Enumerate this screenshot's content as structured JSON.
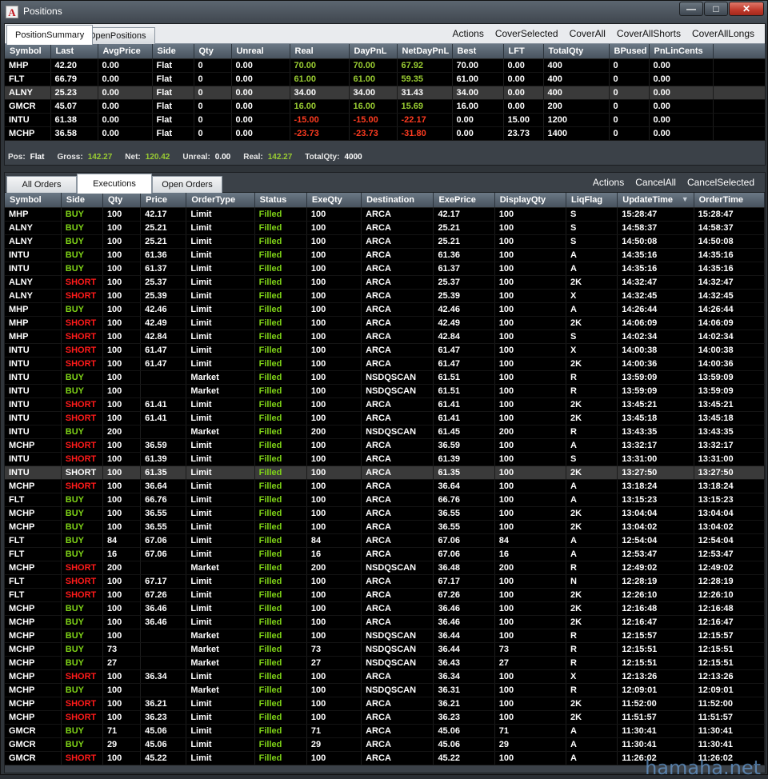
{
  "window": {
    "title": "Positions",
    "icon": "app-logo-icon",
    "controls": [
      "—",
      "□",
      "✕"
    ]
  },
  "summary": {
    "tabs": [
      "PositionSummary",
      "OpenPositions"
    ],
    "actions": [
      "Actions",
      "CoverSelected",
      "CoverAll",
      "CoverAllShorts",
      "CoverAllLongs"
    ],
    "columns": [
      "Symbol",
      "Last",
      "AvgPrice",
      "Side",
      "Qty",
      "Unreal",
      "Real",
      "DayPnL",
      "NetDayPnL",
      "Best",
      "LFT",
      "TotalQty",
      "BPused",
      "PnLinCents"
    ],
    "rows": [
      [
        "MHP",
        "42.20",
        "0.00",
        "Flat",
        "0",
        "0.00",
        "70.00",
        "70.00",
        "67.92",
        "70.00",
        "0.00",
        "400",
        "0",
        "0.00"
      ],
      [
        "FLT",
        "66.79",
        "0.00",
        "Flat",
        "0",
        "0.00",
        "61.00",
        "61.00",
        "59.35",
        "61.00",
        "0.00",
        "400",
        "0",
        "0.00"
      ],
      [
        "ALNY",
        "25.23",
        "0.00",
        "Flat",
        "0",
        "0.00",
        "34.00",
        "34.00",
        "31.43",
        "34.00",
        "0.00",
        "400",
        "0",
        "0.00"
      ],
      [
        "GMCR",
        "45.07",
        "0.00",
        "Flat",
        "0",
        "0.00",
        "16.00",
        "16.00",
        "15.69",
        "16.00",
        "0.00",
        "200",
        "0",
        "0.00"
      ],
      [
        "INTU",
        "61.38",
        "0.00",
        "Flat",
        "0",
        "0.00",
        "-15.00",
        "-15.00",
        "-22.17",
        "0.00",
        "15.00",
        "1200",
        "0",
        "0.00"
      ],
      [
        "MCHP",
        "36.58",
        "0.00",
        "Flat",
        "0",
        "0.00",
        "-23.73",
        "-23.73",
        "-31.80",
        "0.00",
        "23.73",
        "1400",
        "0",
        "0.00"
      ]
    ],
    "selected_row": 2,
    "status": {
      "pos_label": "Pos:",
      "pos_value": "Flat",
      "gross_label": "Gross:",
      "gross_value": "142.27",
      "net_label": "Net:",
      "net_value": "120.42",
      "unreal_label": "Unreal:",
      "unreal_value": "0.00",
      "real_label": "Real:",
      "real_value": "142.27",
      "totalqty_label": "TotalQty:",
      "totalqty_value": "4000"
    }
  },
  "orders": {
    "tabs": [
      "All Orders",
      "Executions",
      "Open Orders"
    ],
    "active_tab": 1,
    "actions": [
      "Actions",
      "CancelAll",
      "CancelSelected"
    ],
    "columns": [
      "Symbol",
      "Side",
      "Qty",
      "Price",
      "OrderType",
      "Status",
      "ExeQty",
      "Destination",
      "ExePrice",
      "DisplayQty",
      "LiqFlag",
      "UpdateTime",
      "OrderTime"
    ],
    "sort_indicator": "▼",
    "rows": [
      [
        "MHP",
        "BUY",
        "100",
        "42.17",
        "Limit",
        "Filled",
        "100",
        "ARCA",
        "42.17",
        "100",
        "S",
        "15:28:47",
        "15:28:47"
      ],
      [
        "ALNY",
        "BUY",
        "100",
        "25.21",
        "Limit",
        "Filled",
        "100",
        "ARCA",
        "25.21",
        "100",
        "S",
        "14:58:37",
        "14:58:37"
      ],
      [
        "ALNY",
        "BUY",
        "100",
        "25.21",
        "Limit",
        "Filled",
        "100",
        "ARCA",
        "25.21",
        "100",
        "S",
        "14:50:08",
        "14:50:08"
      ],
      [
        "INTU",
        "BUY",
        "100",
        "61.36",
        "Limit",
        "Filled",
        "100",
        "ARCA",
        "61.36",
        "100",
        "A",
        "14:35:16",
        "14:35:16"
      ],
      [
        "INTU",
        "BUY",
        "100",
        "61.37",
        "Limit",
        "Filled",
        "100",
        "ARCA",
        "61.37",
        "100",
        "A",
        "14:35:16",
        "14:35:16"
      ],
      [
        "ALNY",
        "SHORT",
        "100",
        "25.37",
        "Limit",
        "Filled",
        "100",
        "ARCA",
        "25.37",
        "100",
        "2K",
        "14:32:47",
        "14:32:47"
      ],
      [
        "ALNY",
        "SHORT",
        "100",
        "25.39",
        "Limit",
        "Filled",
        "100",
        "ARCA",
        "25.39",
        "100",
        "X",
        "14:32:45",
        "14:32:45"
      ],
      [
        "MHP",
        "BUY",
        "100",
        "42.46",
        "Limit",
        "Filled",
        "100",
        "ARCA",
        "42.46",
        "100",
        "A",
        "14:26:44",
        "14:26:44"
      ],
      [
        "MHP",
        "SHORT",
        "100",
        "42.49",
        "Limit",
        "Filled",
        "100",
        "ARCA",
        "42.49",
        "100",
        "2K",
        "14:06:09",
        "14:06:09"
      ],
      [
        "MHP",
        "SHORT",
        "100",
        "42.84",
        "Limit",
        "Filled",
        "100",
        "ARCA",
        "42.84",
        "100",
        "S",
        "14:02:34",
        "14:02:34"
      ],
      [
        "INTU",
        "SHORT",
        "100",
        "61.47",
        "Limit",
        "Filled",
        "100",
        "ARCA",
        "61.47",
        "100",
        "X",
        "14:00:38",
        "14:00:38"
      ],
      [
        "INTU",
        "SHORT",
        "100",
        "61.47",
        "Limit",
        "Filled",
        "100",
        "ARCA",
        "61.47",
        "100",
        "2K",
        "14:00:36",
        "14:00:36"
      ],
      [
        "INTU",
        "BUY",
        "100",
        "",
        "Market",
        "Filled",
        "100",
        "NSDQSCAN",
        "61.51",
        "100",
        "R",
        "13:59:09",
        "13:59:09"
      ],
      [
        "INTU",
        "BUY",
        "100",
        "",
        "Market",
        "Filled",
        "100",
        "NSDQSCAN",
        "61.51",
        "100",
        "R",
        "13:59:09",
        "13:59:09"
      ],
      [
        "INTU",
        "SHORT",
        "100",
        "61.41",
        "Limit",
        "Filled",
        "100",
        "ARCA",
        "61.41",
        "100",
        "2K",
        "13:45:21",
        "13:45:21"
      ],
      [
        "INTU",
        "SHORT",
        "100",
        "61.41",
        "Limit",
        "Filled",
        "100",
        "ARCA",
        "61.41",
        "100",
        "2K",
        "13:45:18",
        "13:45:18"
      ],
      [
        "INTU",
        "BUY",
        "200",
        "",
        "Market",
        "Filled",
        "200",
        "NSDQSCAN",
        "61.45",
        "200",
        "R",
        "13:43:35",
        "13:43:35"
      ],
      [
        "MCHP",
        "SHORT",
        "100",
        "36.59",
        "Limit",
        "Filled",
        "100",
        "ARCA",
        "36.59",
        "100",
        "A",
        "13:32:17",
        "13:32:17"
      ],
      [
        "INTU",
        "SHORT",
        "100",
        "61.39",
        "Limit",
        "Filled",
        "100",
        "ARCA",
        "61.39",
        "100",
        "S",
        "13:31:00",
        "13:31:00"
      ],
      [
        "INTU",
        "SHORT",
        "100",
        "61.35",
        "Limit",
        "Filled",
        "100",
        "ARCA",
        "61.35",
        "100",
        "2K",
        "13:27:50",
        "13:27:50"
      ],
      [
        "MCHP",
        "SHORT",
        "100",
        "36.64",
        "Limit",
        "Filled",
        "100",
        "ARCA",
        "36.64",
        "100",
        "A",
        "13:18:24",
        "13:18:24"
      ],
      [
        "FLT",
        "BUY",
        "100",
        "66.76",
        "Limit",
        "Filled",
        "100",
        "ARCA",
        "66.76",
        "100",
        "A",
        "13:15:23",
        "13:15:23"
      ],
      [
        "MCHP",
        "BUY",
        "100",
        "36.55",
        "Limit",
        "Filled",
        "100",
        "ARCA",
        "36.55",
        "100",
        "2K",
        "13:04:04",
        "13:04:04"
      ],
      [
        "MCHP",
        "BUY",
        "100",
        "36.55",
        "Limit",
        "Filled",
        "100",
        "ARCA",
        "36.55",
        "100",
        "2K",
        "13:04:02",
        "13:04:02"
      ],
      [
        "FLT",
        "BUY",
        "84",
        "67.06",
        "Limit",
        "Filled",
        "84",
        "ARCA",
        "67.06",
        "84",
        "A",
        "12:54:04",
        "12:54:04"
      ],
      [
        "FLT",
        "BUY",
        "16",
        "67.06",
        "Limit",
        "Filled",
        "16",
        "ARCA",
        "67.06",
        "16",
        "A",
        "12:53:47",
        "12:53:47"
      ],
      [
        "MCHP",
        "SHORT",
        "200",
        "",
        "Market",
        "Filled",
        "200",
        "NSDQSCAN",
        "36.48",
        "200",
        "R",
        "12:49:02",
        "12:49:02"
      ],
      [
        "FLT",
        "SHORT",
        "100",
        "67.17",
        "Limit",
        "Filled",
        "100",
        "ARCA",
        "67.17",
        "100",
        "N",
        "12:28:19",
        "12:28:19"
      ],
      [
        "FLT",
        "SHORT",
        "100",
        "67.26",
        "Limit",
        "Filled",
        "100",
        "ARCA",
        "67.26",
        "100",
        "2K",
        "12:26:10",
        "12:26:10"
      ],
      [
        "MCHP",
        "BUY",
        "100",
        "36.46",
        "Limit",
        "Filled",
        "100",
        "ARCA",
        "36.46",
        "100",
        "2K",
        "12:16:48",
        "12:16:48"
      ],
      [
        "MCHP",
        "BUY",
        "100",
        "36.46",
        "Limit",
        "Filled",
        "100",
        "ARCA",
        "36.46",
        "100",
        "2K",
        "12:16:47",
        "12:16:47"
      ],
      [
        "MCHP",
        "BUY",
        "100",
        "",
        "Market",
        "Filled",
        "100",
        "NSDQSCAN",
        "36.44",
        "100",
        "R",
        "12:15:57",
        "12:15:57"
      ],
      [
        "MCHP",
        "BUY",
        "73",
        "",
        "Market",
        "Filled",
        "73",
        "NSDQSCAN",
        "36.44",
        "73",
        "R",
        "12:15:51",
        "12:15:51"
      ],
      [
        "MCHP",
        "BUY",
        "27",
        "",
        "Market",
        "Filled",
        "27",
        "NSDQSCAN",
        "36.43",
        "27",
        "R",
        "12:15:51",
        "12:15:51"
      ],
      [
        "MCHP",
        "SHORT",
        "100",
        "36.34",
        "Limit",
        "Filled",
        "100",
        "ARCA",
        "36.34",
        "100",
        "X",
        "12:13:26",
        "12:13:26"
      ],
      [
        "MCHP",
        "BUY",
        "100",
        "",
        "Market",
        "Filled",
        "100",
        "NSDQSCAN",
        "36.31",
        "100",
        "R",
        "12:09:01",
        "12:09:01"
      ],
      [
        "MCHP",
        "SHORT",
        "100",
        "36.21",
        "Limit",
        "Filled",
        "100",
        "ARCA",
        "36.21",
        "100",
        "2K",
        "11:52:00",
        "11:52:00"
      ],
      [
        "MCHP",
        "SHORT",
        "100",
        "36.23",
        "Limit",
        "Filled",
        "100",
        "ARCA",
        "36.23",
        "100",
        "2K",
        "11:51:57",
        "11:51:57"
      ],
      [
        "GMCR",
        "BUY",
        "71",
        "45.06",
        "Limit",
        "Filled",
        "71",
        "ARCA",
        "45.06",
        "71",
        "A",
        "11:30:41",
        "11:30:41"
      ],
      [
        "GMCR",
        "BUY",
        "29",
        "45.06",
        "Limit",
        "Filled",
        "29",
        "ARCA",
        "45.06",
        "29",
        "A",
        "11:30:41",
        "11:30:41"
      ],
      [
        "GMCR",
        "SHORT",
        "100",
        "45.22",
        "Limit",
        "Filled",
        "100",
        "ARCA",
        "45.22",
        "100",
        "A",
        "11:26:02",
        "11:26:02"
      ]
    ],
    "selected_row": 19
  },
  "watermark": "hamaha.net",
  "colors": {
    "positive": "#9acd32",
    "negative": "#ff3b20",
    "buy": "#7fd317",
    "short": "#ff1a1a",
    "filled": "#7fd317"
  }
}
